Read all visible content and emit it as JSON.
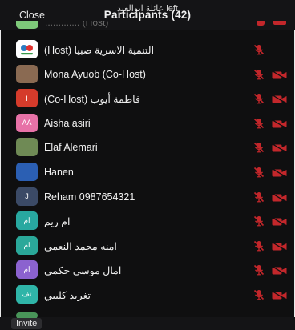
{
  "header": {
    "toast": "عائلة ابوالعيد left",
    "close_label": "Close",
    "title": "Participants (42)"
  },
  "cutoff_row": {
    "name": "............. (Host)",
    "avatar_color": "#7ec97a"
  },
  "participants": [
    {
      "name": "(Host) التنمية الاسرية صبيا",
      "avatar_type": "logo",
      "avatar_text": "",
      "avatar_color": "#ffffff",
      "mic": "muted-red",
      "video": "none"
    },
    {
      "name": "Mona Ayuob (Co-Host)",
      "avatar_type": "photo",
      "avatar_text": "",
      "avatar_color": "#8a6a52",
      "mic": "muted-red",
      "video": "off-red"
    },
    {
      "name": "(Co-Host) فاطمة أيوب",
      "avatar_type": "initial",
      "avatar_text": "I",
      "avatar_color": "#d53b2b",
      "mic": "muted-red",
      "video": "off-red"
    },
    {
      "name": "Aisha asiri",
      "avatar_type": "initial",
      "avatar_text": "AA",
      "avatar_color": "#e772a7",
      "mic": "muted-red",
      "video": "off-red"
    },
    {
      "name": "Elaf Alemari",
      "avatar_type": "photo",
      "avatar_text": "",
      "avatar_color": "#6f8a55",
      "mic": "muted-red",
      "video": "off-red"
    },
    {
      "name": "Hanen",
      "avatar_type": "initial",
      "avatar_text": "",
      "avatar_color": "#2b5fb3",
      "mic": "muted-red",
      "video": "off-red"
    },
    {
      "name": "Reham 0987654321",
      "avatar_type": "initial",
      "avatar_text": "J",
      "avatar_color": "#3b4a66",
      "mic": "muted-red",
      "video": "off-red"
    },
    {
      "name": "ام ريم",
      "avatar_type": "initial",
      "avatar_text": "ام",
      "avatar_color": "#28a8a0",
      "mic": "muted-red",
      "video": "off-red"
    },
    {
      "name": "امنه محمد النعمي",
      "avatar_type": "initial",
      "avatar_text": "ام",
      "avatar_color": "#2aa89a",
      "mic": "muted-red",
      "video": "off-red"
    },
    {
      "name": "امال موسى حكمي",
      "avatar_type": "initial",
      "avatar_text": "ام",
      "avatar_color": "#8b62cf",
      "mic": "muted-red",
      "video": "off-red"
    },
    {
      "name": "تغريد كليبي",
      "avatar_type": "initial",
      "avatar_text": "تف",
      "avatar_color": "#2fb5a8",
      "mic": "muted-red",
      "video": "off-red"
    }
  ],
  "footer": {
    "invite_label": "Invite"
  },
  "colors": {
    "background": "#0f0f10",
    "muted_icon": "#c3272b",
    "text": "#f0f0f0"
  }
}
